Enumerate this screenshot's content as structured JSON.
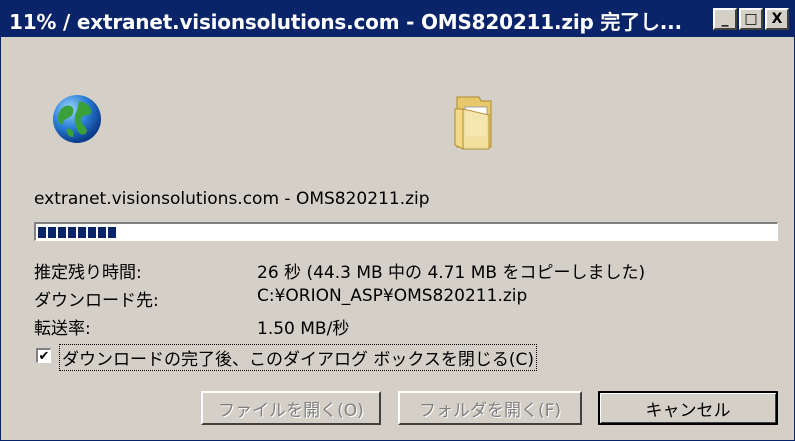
{
  "window": {
    "title": "11% / extranet.visionsolutions.com - OMS820211.zip 完了し...",
    "controls": {
      "minimize": "_",
      "maximize": "□",
      "close": "X"
    }
  },
  "icons": {
    "source": "globe-icon",
    "destination": "folder-icon"
  },
  "download": {
    "source_line": "extranet.visionsolutions.com - OMS820211.zip",
    "progress_percent": 11
  },
  "info": {
    "remaining_label": "推定残り時間:",
    "remaining_value": "26 秒 (44.3 MB 中の 4.71 MB をコピーしました)",
    "destination_label": "ダウンロード先:",
    "destination_value": "C:¥ORION_ASP¥OMS820211.zip",
    "rate_label": "転送率:",
    "rate_value": "1.50 MB/秒"
  },
  "close_on_complete": {
    "checked": true,
    "label": "ダウンロードの完了後、このダイアログ ボックスを閉じる(C)"
  },
  "buttons": {
    "open_file": "ファイルを開く(O)",
    "open_folder": "フォルダを開く(F)",
    "cancel": "キャンセル"
  },
  "colors": {
    "titlebar": "#0a246a",
    "dialog": "#d4d0c8",
    "progress": "#0a246a"
  }
}
